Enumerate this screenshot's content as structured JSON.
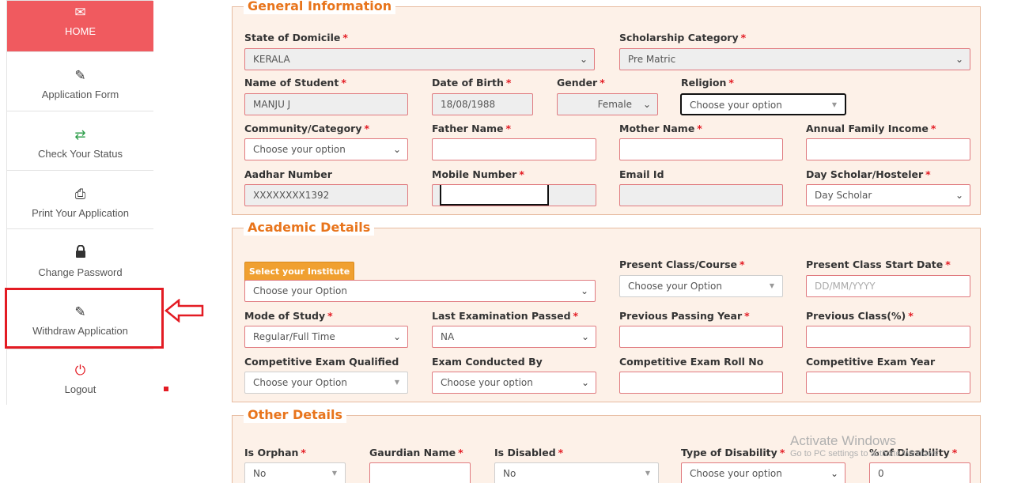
{
  "sidebar": {
    "items": [
      {
        "label": "HOME",
        "icon": "envelope-icon"
      },
      {
        "label": "Application Form",
        "icon": "edit-icon"
      },
      {
        "label": "Check Your Status",
        "icon": "transfer-icon"
      },
      {
        "label": "Print Your Application",
        "icon": "print-icon"
      },
      {
        "label": "Change Password",
        "icon": "lock-icon"
      },
      {
        "label": "Withdraw Application",
        "icon": "edit-icon"
      },
      {
        "label": "Logout",
        "icon": "power-icon"
      }
    ],
    "active_color": "#f05a5f"
  },
  "general": {
    "legend": "General Information",
    "state_label": "State of Domicile",
    "state_value": "KERALA",
    "scholarship_label": "Scholarship Category",
    "scholarship_value": "Pre Matric",
    "name_label": "Name of Student",
    "name_value": "MANJU J",
    "dob_label": "Date of Birth",
    "dob_value": "18/08/1988",
    "gender_label": "Gender",
    "gender_value": "Female",
    "religion_label": "Religion",
    "religion_value": "Choose your option",
    "community_label": "Community/Category",
    "community_value": "Choose your option",
    "father_label": "Father Name",
    "mother_label": "Mother Name",
    "income_label": "Annual Family Income",
    "aadhar_label": "Aadhar Number",
    "aadhar_value": "XXXXXXXX1392",
    "mobile_label": "Mobile Number",
    "email_label": "Email Id",
    "dayscholar_label": "Day Scholar/Hosteler",
    "dayscholar_value": "Day Scholar"
  },
  "academic": {
    "legend": "Academic Details",
    "institute_button": "Select your Institute",
    "institute_value": "Choose your Option",
    "present_class_label": "Present Class/Course",
    "present_class_value": "Choose your Option",
    "start_date_label": "Present Class Start Date",
    "start_date_placeholder": "DD/MM/YYYY",
    "mode_label": "Mode of Study",
    "mode_value": "Regular/Full Time",
    "last_exam_label": "Last Examination Passed",
    "last_exam_value": "NA",
    "prev_year_label": "Previous Passing Year",
    "prev_class_label": "Previous Class(%)",
    "comp_exam_label": "Competitive Exam Qualified",
    "comp_exam_value": "Choose your Option",
    "conducted_label": "Exam Conducted By",
    "conducted_value": "Choose your option",
    "roll_label": "Competitive Exam Roll No",
    "comp_year_label": "Competitive Exam Year"
  },
  "other": {
    "legend": "Other Details",
    "orphan_label": "Is Orphan",
    "orphan_value": "No",
    "guardian_label": "Gaurdian Name",
    "disabled_label": "Is Disabled",
    "disabled_value": "No",
    "disability_type_label": "Type of Disability",
    "disability_type_value": "Choose your option",
    "disability_pct_label": "% of Disability",
    "disability_pct_value": "0"
  },
  "required_marker": "*",
  "watermark": {
    "line1": "Activate Windows",
    "line2": "Go to PC settings to activate Windows"
  }
}
